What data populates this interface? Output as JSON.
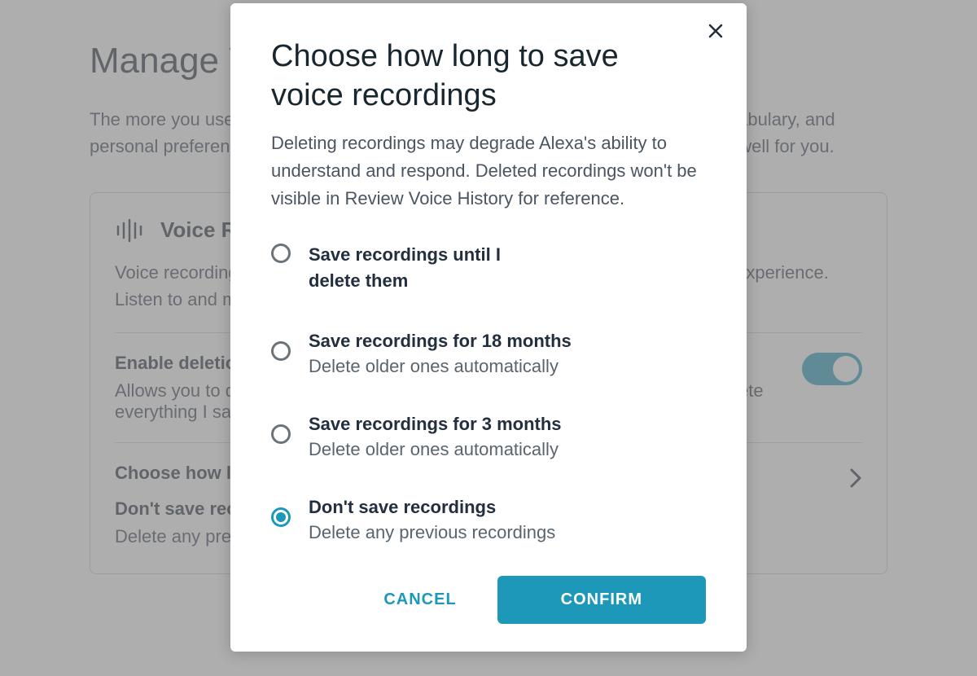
{
  "page": {
    "title": "Manage Your Alexa Data",
    "intro": "The more you use Alexa, the more she adapts to your voice, speech patterns, vocabulary, and personal preferences. Reviewing your voice recordings helps ensure Alexa works well for you.",
    "card": {
      "heading": "Voice Recordings",
      "desc": "Voice recordings help improve the accuracy of your interactions and the Alexa experience. Listen to and manage your recordings below.",
      "enable_label": "Enable deletion by voice",
      "enable_desc": "Allows you to delete recordings by voice. For example, you can say \"Alexa, delete everything I said today.\"",
      "choose_label": "Choose how long to save recordings",
      "choose_value": "Don't save recordings",
      "choose_sub": "Delete any previous recordings"
    }
  },
  "dialog": {
    "title": "Choose how long to save voice recordings",
    "subtitle": "Deleting recordings may degrade Alexa's ability to understand and respond. Deleted recordings won't be visible in Review Voice History for reference.",
    "options": [
      {
        "main": "Save recordings until I delete them",
        "secondary": "",
        "selected": false
      },
      {
        "main": "Save recordings for 18 months",
        "secondary": "Delete older ones automatically",
        "selected": false
      },
      {
        "main": "Save recordings for 3 months",
        "secondary": "Delete older ones automatically",
        "selected": false
      },
      {
        "main": "Don't save recordings",
        "secondary": "Delete any previous recordings",
        "selected": true
      }
    ],
    "cancel": "CANCEL",
    "confirm": "CONFIRM"
  }
}
